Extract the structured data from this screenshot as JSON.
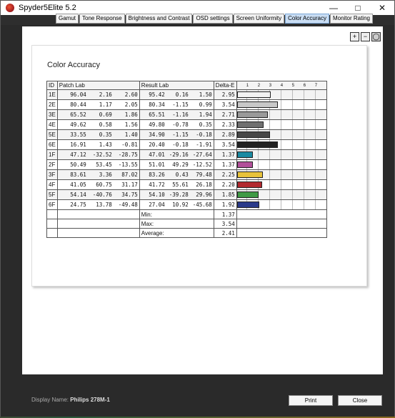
{
  "window": {
    "title": "Spyder5Elite 5.2"
  },
  "tabs": [
    {
      "label": "Gamut",
      "active": false
    },
    {
      "label": "Tone Response",
      "active": false
    },
    {
      "label": "Brightness and Contrast",
      "active": false
    },
    {
      "label": "OSD settings",
      "active": false
    },
    {
      "label": "Screen Uniformity",
      "active": false
    },
    {
      "label": "Color Accuracy",
      "active": true
    },
    {
      "label": "Monitor Rating",
      "active": false
    }
  ],
  "report": {
    "title": "Color Accuracy",
    "headers": {
      "id": "ID",
      "patch": "Patch Lab",
      "result": "Result Lab",
      "delta": "Delta-E"
    },
    "scale": [
      "1",
      "2",
      "3",
      "4",
      "5",
      "6",
      "7"
    ],
    "rows": [
      {
        "id": "1E",
        "patch": [
          "96.04",
          "2.16",
          "2.60"
        ],
        "result": [
          "95.42",
          "0.16",
          "1.50"
        ],
        "delta": "2.95",
        "de": 2.95,
        "color": "#f2f2f2"
      },
      {
        "id": "2E",
        "patch": [
          "80.44",
          "1.17",
          "2.05"
        ],
        "result": [
          "80.34",
          "-1.15",
          "0.99"
        ],
        "delta": "3.54",
        "de": 3.54,
        "color": "#c8c8c8"
      },
      {
        "id": "3E",
        "patch": [
          "65.52",
          "0.69",
          "1.86"
        ],
        "result": [
          "65.51",
          "-1.16",
          "1.94"
        ],
        "delta": "2.71",
        "de": 2.71,
        "color": "#9a9a9a"
      },
      {
        "id": "4E",
        "patch": [
          "49.62",
          "0.58",
          "1.56"
        ],
        "result": [
          "49.80",
          "-0.78",
          "0.35"
        ],
        "delta": "2.33",
        "de": 2.33,
        "color": "#707070"
      },
      {
        "id": "5E",
        "patch": [
          "33.55",
          "0.35",
          "1.40"
        ],
        "result": [
          "34.90",
          "-1.15",
          "-0.18"
        ],
        "delta": "2.89",
        "de": 2.89,
        "color": "#484848"
      },
      {
        "id": "6E",
        "patch": [
          "16.91",
          "1.43",
          "-0.81"
        ],
        "result": [
          "20.40",
          "-0.18",
          "-1.91"
        ],
        "delta": "3.54",
        "de": 3.54,
        "color": "#222222"
      },
      {
        "id": "1F",
        "patch": [
          "47.12",
          "-32.52",
          "-28.75"
        ],
        "result": [
          "47.01",
          "-29.16",
          "-27.64"
        ],
        "delta": "1.37",
        "de": 1.37,
        "color": "#1a8aa2"
      },
      {
        "id": "2F",
        "patch": [
          "50.49",
          "53.45",
          "-13.55"
        ],
        "result": [
          "51.01",
          "49.29",
          "-12.52"
        ],
        "delta": "1.37",
        "de": 1.37,
        "color": "#b2509a"
      },
      {
        "id": "3F",
        "patch": [
          "83.61",
          "3.36",
          "87.02"
        ],
        "result": [
          "83.26",
          "0.43",
          "79.48"
        ],
        "delta": "2.25",
        "de": 2.25,
        "color": "#e8c33a"
      },
      {
        "id": "4F",
        "patch": [
          "41.05",
          "60.75",
          "31.17"
        ],
        "result": [
          "41.72",
          "55.61",
          "26.18"
        ],
        "delta": "2.20",
        "de": 2.2,
        "color": "#b2292f"
      },
      {
        "id": "5F",
        "patch": [
          "54.14",
          "-40.76",
          "34.75"
        ],
        "result": [
          "54.10",
          "-39.28",
          "29.96"
        ],
        "delta": "1.85",
        "de": 1.85,
        "color": "#3f9a45"
      },
      {
        "id": "6F",
        "patch": [
          "24.75",
          "13.78",
          "-49.48"
        ],
        "result": [
          "27.04",
          "10.92",
          "-45.68"
        ],
        "delta": "1.92",
        "de": 1.92,
        "color": "#2a3a8a"
      }
    ],
    "summary": [
      {
        "label": "Min:",
        "value": "1.37"
      },
      {
        "label": "Max:",
        "value": "3.54"
      },
      {
        "label": "Average:",
        "value": "2.41"
      }
    ]
  },
  "footer": {
    "display_label": "Display Name:",
    "display_value": "Philips 278M-1",
    "print_label": "Print",
    "close_label": "Close"
  }
}
